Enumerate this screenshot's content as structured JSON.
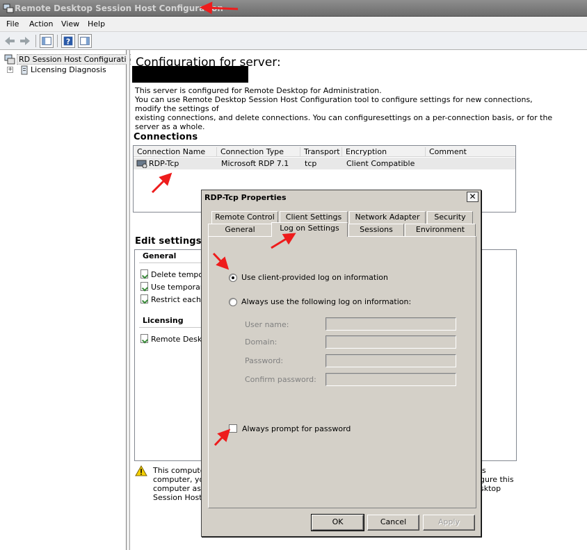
{
  "window": {
    "title": "Remote Desktop Session Host Configuration"
  },
  "menu": [
    "File",
    "Action",
    "View",
    "Help"
  ],
  "tree": {
    "root": "RD Session Host Configuration:",
    "child": "Licensing Diagnosis"
  },
  "main": {
    "title": "Configuration for server:",
    "description": [
      "This server is configured for Remote Desktop for Administration.",
      "You can use Remote Desktop Session Host Configuration tool to configure settings for new connections, modify the settings of",
      "existing connections, and delete connections. You can configuresettings on a per-connection basis, or for the server as a whole."
    ],
    "connections_heading": "Connections",
    "columns": [
      "Connection Name",
      "Connection Type",
      "Transport",
      "Encryption",
      "Comment"
    ],
    "rows": [
      {
        "name": "RDP-Tcp",
        "type": "Microsoft RDP 7.1",
        "transport": "tcp",
        "encryption": "Client Compatible",
        "comment": ""
      }
    ],
    "edit_heading": "Edit settings",
    "general_group": "General",
    "general_items": [
      "Delete tempora",
      "Use temporary f",
      "Restrict each u"
    ],
    "licensing_group": "Licensing",
    "licensing_items": [
      "Remote Deskto"
    ],
    "warning_lines": [
      "This computer",
      "computer, you",
      "computer as a",
      "Session Host r"
    ],
    "warning_right": [
      "is",
      "gure this",
      "sktop"
    ]
  },
  "dialog": {
    "title": "RDP-Tcp Properties",
    "close": "✕",
    "tabs_row1": [
      "Remote Control",
      "Client Settings",
      "Network Adapter",
      "Security"
    ],
    "tabs_row2": [
      "General",
      "Log on Settings",
      "Sessions",
      "Environment"
    ],
    "active_tab": "Log on Settings",
    "option_client": "Use client-provided log on information",
    "option_always": "Always use the following log on information:",
    "fields": [
      "User name:",
      "Domain:",
      "Password:",
      "Confirm password:"
    ],
    "prompt": "Always prompt for password",
    "prompt_checked": false,
    "selected_option": "client",
    "buttons": {
      "ok": "OK",
      "cancel": "Cancel",
      "apply": "Apply"
    }
  },
  "colors": {
    "annotation_red": "#ee1c1c",
    "titlebar": "#7a7a7a"
  }
}
